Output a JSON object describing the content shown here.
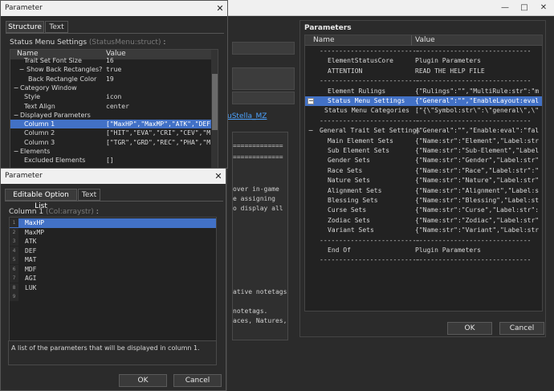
{
  "background": {
    "link_text": "uStella_MZ",
    "text_snippets": [
      "=============",
      "=============",
      "over in-game",
      "e assigning",
      "o display all",
      "ative notetags.",
      "notetags.",
      "aces, Natures,"
    ]
  },
  "params_panel": {
    "title": "Parameters",
    "col_name": "Name",
    "col_value": "Value",
    "rows": [
      {
        "name": "--------------------------",
        "value": "------------------------------"
      },
      {
        "name": "ElementStatusCore",
        "value": "Plugin Parameters"
      },
      {
        "name": "ATTENTION",
        "value": "READ THE HELP FILE"
      },
      {
        "name": "--------------------------",
        "value": "------------------------------"
      },
      {
        "name": "Element Rulings",
        "value": "{\"Rulings\":\"\",\"MultiRule:str\":\"m"
      },
      {
        "name": "Status Menu Settings",
        "value": "{\"General\":\"\",\"EnableLayout:eval"
      },
      {
        "name": "Status Menu Categories",
        "value": "[\"{\\\"Symbol:str\\\":\\\"general\\\",\\\""
      },
      {
        "name": "--------------------------",
        "value": "------------------------------"
      },
      {
        "name": "General Trait Set Settings",
        "value": "{\"General\":\"\",\"Enable:eval\":\"fal"
      },
      {
        "name": "Main Element Sets",
        "value": "{\"Name:str\":\"Element\",\"Label:str"
      },
      {
        "name": "Sub Element Sets",
        "value": "{\"Name:str\":\"Sub-Element\",\"Label"
      },
      {
        "name": "Gender Sets",
        "value": "{\"Name:str\":\"Gender\",\"Label:str\""
      },
      {
        "name": "Race Sets",
        "value": "{\"Name:str\":\"Race\",\"Label:str\":\""
      },
      {
        "name": "Nature Sets",
        "value": "{\"Name:str\":\"Nature\",\"Label:str\""
      },
      {
        "name": "Alignment Sets",
        "value": "{\"Name:str\":\"Alignment\",\"Label:s"
      },
      {
        "name": "Blessing Sets",
        "value": "{\"Name:str\":\"Blessing\",\"Label:st"
      },
      {
        "name": "Curse Sets",
        "value": "{\"Name:str\":\"Curse\",\"Label:str\":"
      },
      {
        "name": "Zodiac Sets",
        "value": "{\"Name:str\":\"Zodiac\",\"Label:str\""
      },
      {
        "name": "Variant Sets",
        "value": "{\"Name:str\":\"Variant\",\"Label:str"
      },
      {
        "name": "--------------------------",
        "value": "------------------------------"
      },
      {
        "name": "End Of",
        "value": "Plugin Parameters"
      },
      {
        "name": "--------------------------",
        "value": "------------------------------"
      }
    ],
    "ok_label": "OK",
    "cancel_label": "Cancel"
  },
  "dialog1": {
    "title": "Parameter",
    "tabs": [
      "Structure",
      "Text"
    ],
    "label": "Status Menu Settings",
    "label_type": "(StatusMenu:struct)",
    "col_name": "Name",
    "col_value": "Value",
    "rows": [
      {
        "name": "Trait Set Font Size",
        "value": "16"
      },
      {
        "name": "Show Back Rectangles?",
        "value": "true"
      },
      {
        "name": "Back Rectangle Color",
        "value": "19"
      },
      {
        "name": "Category Window",
        "value": ""
      },
      {
        "name": "Style",
        "value": "icon"
      },
      {
        "name": "Text Align",
        "value": "center"
      },
      {
        "name": "Displayed Parameters",
        "value": ""
      },
      {
        "name": "Column 1",
        "value": "[\"MaxHP\",\"MaxMP\",\"ATK\",\"DEF\""
      },
      {
        "name": "Column 2",
        "value": "[\"HIT\",\"EVA\",\"CRI\",\"CEV\",\"M"
      },
      {
        "name": "Column 3",
        "value": "[\"TGR\",\"GRD\",\"REC\",\"PHA\",\"M"
      },
      {
        "name": "Elements",
        "value": ""
      },
      {
        "name": "Excluded Elements",
        "value": "[]"
      }
    ]
  },
  "dialog2": {
    "title": "Parameter",
    "tabs": [
      "Editable Option List",
      "Text"
    ],
    "label": "Column 1",
    "label_type": "(Col:arraystr)",
    "items": [
      "MaxHP",
      "MaxMP",
      "ATK",
      "DEF",
      "MAT",
      "MDF",
      "AGI",
      "LUK",
      ""
    ],
    "numbers": [
      "1",
      "2",
      "3",
      "4",
      "5",
      "6",
      "7",
      "8",
      "9"
    ],
    "description": "A list of the parameters that will be displayed in column 1.",
    "ok_label": "OK",
    "cancel_label": "Cancel"
  },
  "colors": {
    "selection": "#4271c6",
    "panel_bg": "#2b2b2b",
    "title_bar": "#f0f0f0",
    "link": "#4da3ff"
  }
}
